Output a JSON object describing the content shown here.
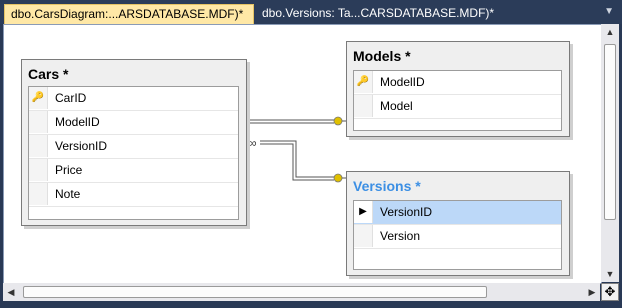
{
  "tabs": [
    {
      "label": "dbo.CarsDiagram:...ARSDATABASE.MDF)*",
      "active": true
    },
    {
      "label": "dbo.Versions: Ta...CARSDATABASE.MDF)*",
      "active": false
    }
  ],
  "tables": {
    "cars": {
      "title": "Cars *",
      "columns": [
        {
          "name": "CarID",
          "key": true
        },
        {
          "name": "ModelID",
          "key": false
        },
        {
          "name": "VersionID",
          "key": false
        },
        {
          "name": "Price",
          "key": false
        },
        {
          "name": "Note",
          "key": false
        }
      ]
    },
    "models": {
      "title": "Models *",
      "columns": [
        {
          "name": "ModelID",
          "key": true
        },
        {
          "name": "Model",
          "key": false
        }
      ]
    },
    "versions": {
      "title": "Versions *",
      "columns": [
        {
          "name": "VersionID",
          "key": true,
          "selected": true
        },
        {
          "name": "Version",
          "key": false
        }
      ]
    }
  },
  "colors": {
    "tab_active": "#ffe8a6",
    "selected_row": "#bcd8f8",
    "versions_title": "#3c8fe4",
    "key_icon": "#d8b000"
  },
  "icons": {
    "key": "key-icon",
    "selector_arrow": "row-selector-arrow-icon",
    "relationship_one": "infinity-end-icon",
    "relationship_many": "key-end-icon",
    "tab_menu": "tab-dropdown-icon",
    "move": "move-cross-icon"
  }
}
